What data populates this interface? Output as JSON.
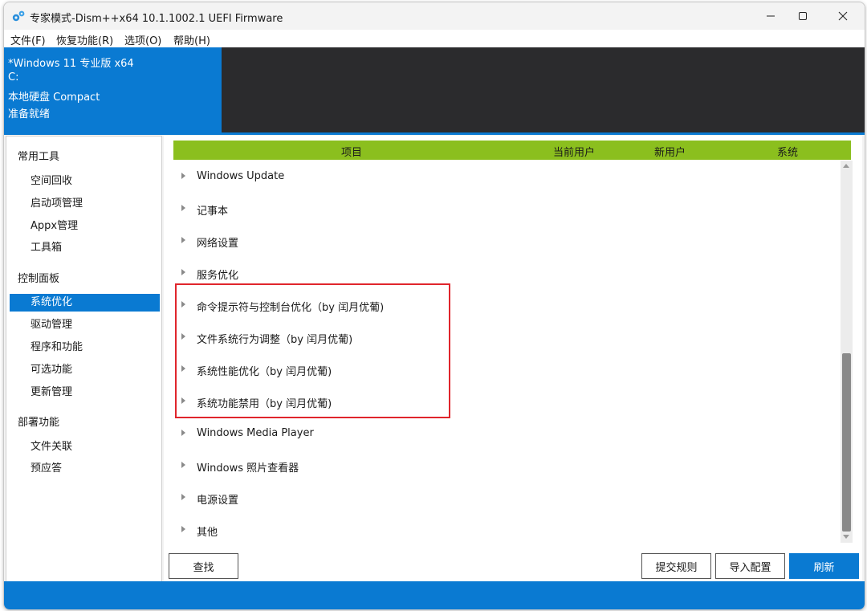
{
  "window": {
    "title": "专家模式-Dism++x64 10.1.1002.1 UEFI Firmware"
  },
  "menu": [
    "文件(F)",
    "恢复功能(R)",
    "选项(O)",
    "帮助(H)"
  ],
  "info": {
    "os": "*Windows 11 专业版 x64",
    "drive": "C:",
    "disk": "本地硬盘 Compact",
    "status": "准备就绪"
  },
  "sidebar": {
    "categories": [
      {
        "label": "常用工具",
        "items": [
          "空间回收",
          "启动项管理",
          "Appx管理",
          "工具箱"
        ]
      },
      {
        "label": "控制面板",
        "items": [
          "系统优化",
          "驱动管理",
          "程序和功能",
          "可选功能",
          "更新管理"
        ]
      },
      {
        "label": "部署功能",
        "items": [
          "文件关联",
          "预应答"
        ]
      }
    ],
    "active": "系统优化"
  },
  "table": {
    "columns": [
      "项目",
      "当前用户",
      "新用户",
      "系统"
    ],
    "rows": [
      "Windows Update",
      "记事本",
      "网络设置",
      "服务优化",
      "命令提示符与控制台优化（by 闰月优葡)",
      "文件系统行为调整（by 闰月优葡)",
      "系统性能优化（by 闰月优葡)",
      "系统功能禁用（by 闰月优葡)",
      "Windows Media Player",
      "Windows 照片查看器",
      "电源设置",
      "其他"
    ]
  },
  "buttons": {
    "find": "查找",
    "submit_rules": "提交规则",
    "import_config": "导入配置",
    "refresh": "刷新"
  },
  "colors": {
    "accent": "#0a7ad2",
    "header_green": "#8bbf1e",
    "highlight_red": "#e0252c",
    "dark_panel": "#2b2b2d"
  }
}
